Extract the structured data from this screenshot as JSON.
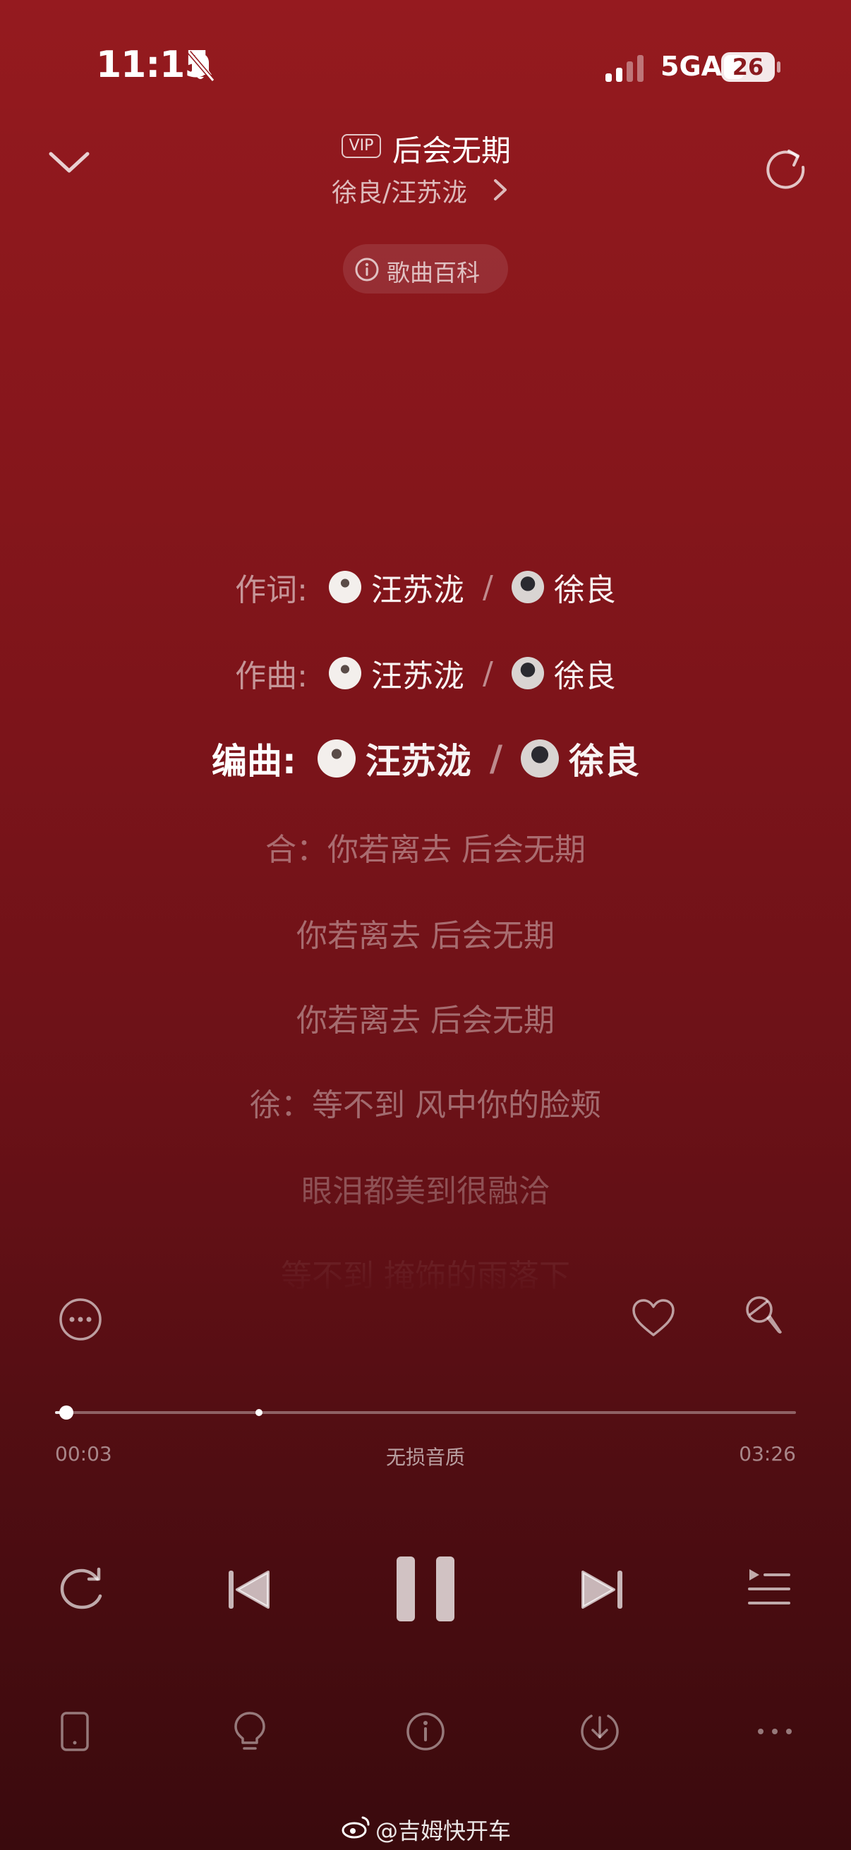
{
  "status_bar": {
    "time": "11:15",
    "network": "5GA",
    "battery": "26",
    "icons": [
      "bell-off-icon",
      "signal-icon",
      "battery-icon"
    ]
  },
  "header": {
    "vip_badge": "VIP",
    "title": "后会无期",
    "artist": "徐良/汪苏泷",
    "icons": [
      "chevron-down-icon",
      "chevron-right-icon",
      "share-icon"
    ]
  },
  "wiki_button": {
    "label": "歌曲百科",
    "icon": "info-icon"
  },
  "credits": [
    {
      "role": "作词:",
      "name_a": "汪苏泷",
      "sep": "/",
      "name_b": "徐良",
      "active": false
    },
    {
      "role": "作曲:",
      "name_a": "汪苏泷",
      "sep": "/",
      "name_b": "徐良",
      "active": false
    },
    {
      "role": "编曲:",
      "name_a": "汪苏泷",
      "sep": "/",
      "name_b": "徐良",
      "active": true
    }
  ],
  "lyrics": [
    "合：你若离去 后会无期",
    "你若离去 后会无期",
    "你若离去 后会无期",
    "徐：等不到 风中你的脸颊",
    "眼泪都美到很融洽",
    "等不到 掩饰的雨落下"
  ],
  "actions": {
    "icons": [
      "more-circle-icon",
      "heart-icon",
      "microphone-icon"
    ]
  },
  "progress": {
    "elapsed": "00:03",
    "total": "03:26",
    "quality": "无损音质",
    "position_fraction": 0.015,
    "buffered_fraction": 0.29
  },
  "transport": {
    "icons": [
      "repeat-icon",
      "previous-icon",
      "pause-icon",
      "next-icon",
      "playlist-icon"
    ]
  },
  "bottom_bar": {
    "icons": [
      "device-icon",
      "bulb-icon",
      "info-icon",
      "download-icon",
      "more-icon"
    ]
  },
  "watermark": {
    "text": "@吉姆快开车",
    "icon": "weibo-icon"
  }
}
